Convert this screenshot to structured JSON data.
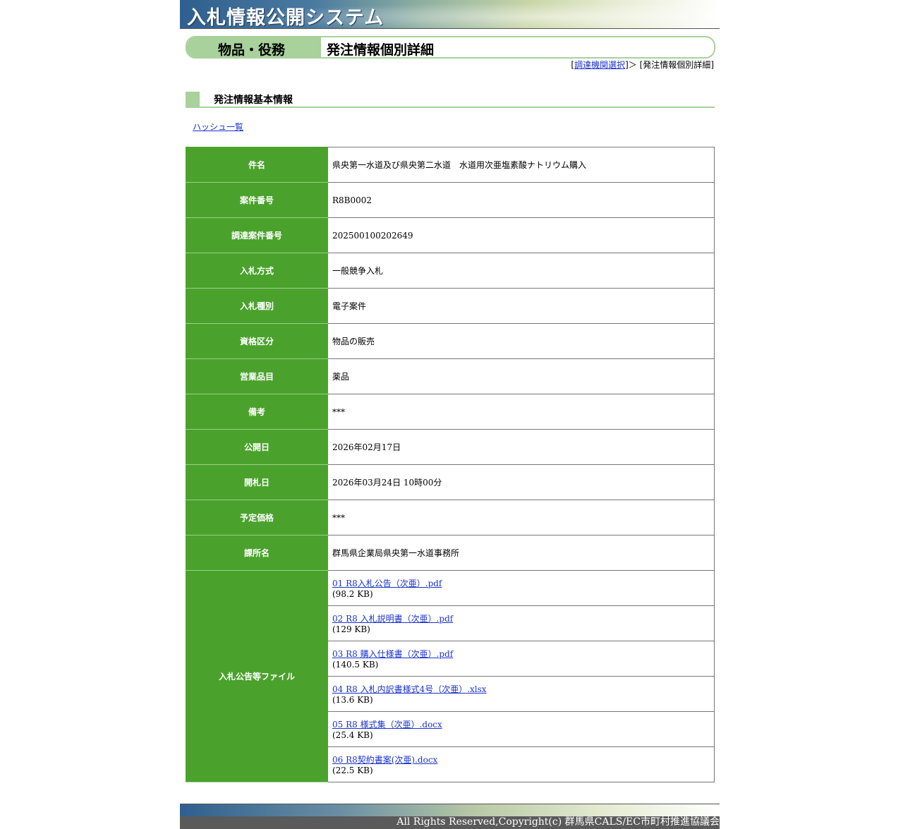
{
  "header": {
    "title": "入札情報公開システム"
  },
  "category_bar": {
    "category": "物品・役務",
    "page_title": "発注情報個別詳細"
  },
  "breadcrumb": {
    "open_bracket": "[",
    "link_label": "調達機関選択",
    "separator": "]＞ [",
    "current": "発注情報個別詳細",
    "close_bracket": "]"
  },
  "section": {
    "title": "発注情報基本情報"
  },
  "hash_link": "ハッシュ一覧",
  "details": [
    {
      "label": "件名",
      "value": "県央第一水道及び県央第二水道　水道用次亜塩素酸ナトリウム購入"
    },
    {
      "label": "案件番号",
      "value": "R8B0002"
    },
    {
      "label": "調達案件番号",
      "value": "202500100202649"
    },
    {
      "label": "入札方式",
      "value": "一般競争入札"
    },
    {
      "label": "入札種別",
      "value": "電子案件"
    },
    {
      "label": "資格区分",
      "value": "物品の販売"
    },
    {
      "label": "営業品目",
      "value": "薬品"
    },
    {
      "label": "備考",
      "value": "***"
    },
    {
      "label": "公開日",
      "value": "2026年02月17日"
    },
    {
      "label": "開札日",
      "value": "2026年03月24日 10時00分"
    },
    {
      "label": "予定価格",
      "value": "***"
    },
    {
      "label": "課所名",
      "value": "群馬県企業局県央第一水道事務所"
    }
  ],
  "files": {
    "label": "入札公告等ファイル",
    "items": [
      {
        "name": "01 R8入札公告（次亜）.pdf",
        "size": "(98.2 KB)"
      },
      {
        "name": "02 R8 入札説明書（次亜）.pdf",
        "size": "(129 KB)"
      },
      {
        "name": "03 R8 購入仕様書（次亜）.pdf",
        "size": "(140.5 KB)"
      },
      {
        "name": "04 R8 入札内訳書様式4号（次亜）.xlsx",
        "size": "(13.6 KB)"
      },
      {
        "name": "05 R8 様式集（次亜）.docx",
        "size": "(25.4 KB)"
      },
      {
        "name": "06 R8契約書案(次亜).docx",
        "size": "(22.5 KB)"
      }
    ]
  },
  "footer": {
    "copyright": "All Rights Reserved,Copyright(c) 群馬県CALS/EC市町村推進協議会"
  },
  "colors": {
    "label_green": "#4aa22c",
    "accent_light_green": "#a8d19b",
    "link_blue": "#1a33cc"
  }
}
